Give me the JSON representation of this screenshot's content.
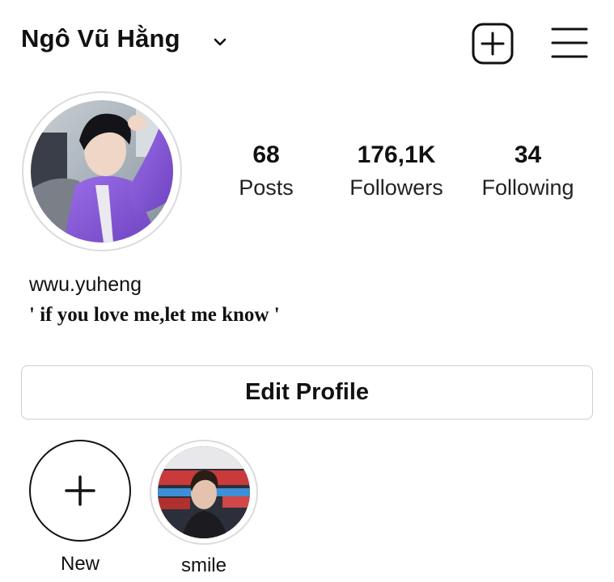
{
  "header": {
    "username": "Ngô Vũ Hằng",
    "icons": {
      "switch_account": "chevron-down-icon",
      "new_post": "plus-square-icon",
      "menu": "hamburger-menu-icon"
    }
  },
  "profile": {
    "avatar": "profile-photo",
    "stats": [
      {
        "value": "68",
        "label": "Posts"
      },
      {
        "value": "176,1K",
        "label": "Followers"
      },
      {
        "value": "34",
        "label": "Following"
      }
    ],
    "name": "wwu.yuheng",
    "bio": "' if you love me,let me know '",
    "edit_button": "Edit Profile"
  },
  "highlights": [
    {
      "label": "New",
      "icon": "plus-icon"
    },
    {
      "label": "smile",
      "image": "highlight-cover-photo"
    }
  ],
  "colors": {
    "text": "#111111",
    "border": "#dbdbdb",
    "button_border": "#cfcfcf",
    "accent_shirt": "#8a5cd8"
  }
}
